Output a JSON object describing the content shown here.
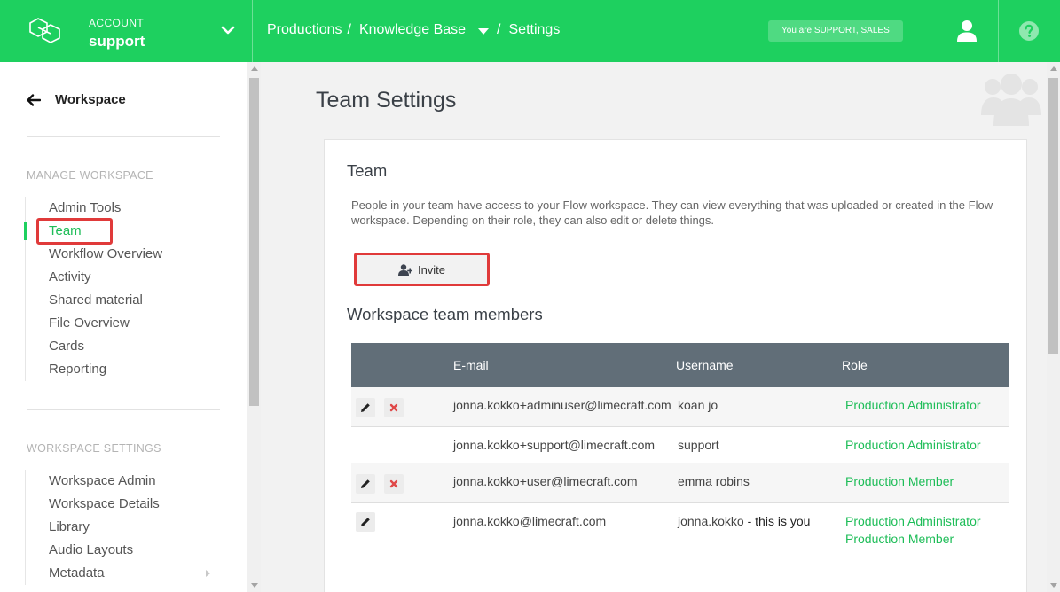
{
  "topbar": {
    "account_label": "ACCOUNT",
    "account_name": "support",
    "breadcrumb": [
      "Productions",
      "Knowledge Base",
      "Settings"
    ],
    "separator": "/",
    "role_badge": "You are SUPPORT, SALES",
    "brand_color": "#1ed05f"
  },
  "sidebar": {
    "back_label": "Workspace",
    "manage_title": "MANAGE WORKSPACE",
    "manage_items": [
      {
        "label": "Admin Tools"
      },
      {
        "label": "Team"
      },
      {
        "label": "Workflow Overview"
      },
      {
        "label": "Activity"
      },
      {
        "label": "Shared material"
      },
      {
        "label": "File Overview"
      },
      {
        "label": "Cards"
      },
      {
        "label": "Reporting"
      }
    ],
    "settings_title": "WORKSPACE SETTINGS",
    "settings_items": [
      {
        "label": "Workspace Admin"
      },
      {
        "label": "Workspace Details"
      },
      {
        "label": "Library"
      },
      {
        "label": "Audio Layouts"
      },
      {
        "label": "Metadata"
      }
    ]
  },
  "main": {
    "page_title": "Team Settings",
    "team_title": "Team",
    "team_description": "People in your team have access to your Flow workspace. They can view everything that was uploaded or created in the Flow workspace. Depending on their role, they can also edit or delete things.",
    "invite_label": "Invite",
    "members_title": "Workspace team members",
    "table": {
      "headers": {
        "email": "E-mail",
        "username": "Username",
        "role": "Role"
      },
      "rows": [
        {
          "email": "jonna.kokko+adminuser@limecraft.com",
          "username": "koan jo",
          "roles": [
            "Production Administrator"
          ]
        },
        {
          "email": "jonna.kokko+support@limecraft.com",
          "username": "support",
          "roles": [
            "Production Administrator"
          ]
        },
        {
          "email": "jonna.kokko+user@limecraft.com",
          "username": "emma robins",
          "roles": [
            "Production Member"
          ]
        },
        {
          "email": "jonna.kokko@limecraft.com",
          "username": "jonna.kokko",
          "username_suffix": " - this is you",
          "roles": [
            "Production Administrator",
            "Production Member"
          ]
        }
      ]
    }
  }
}
